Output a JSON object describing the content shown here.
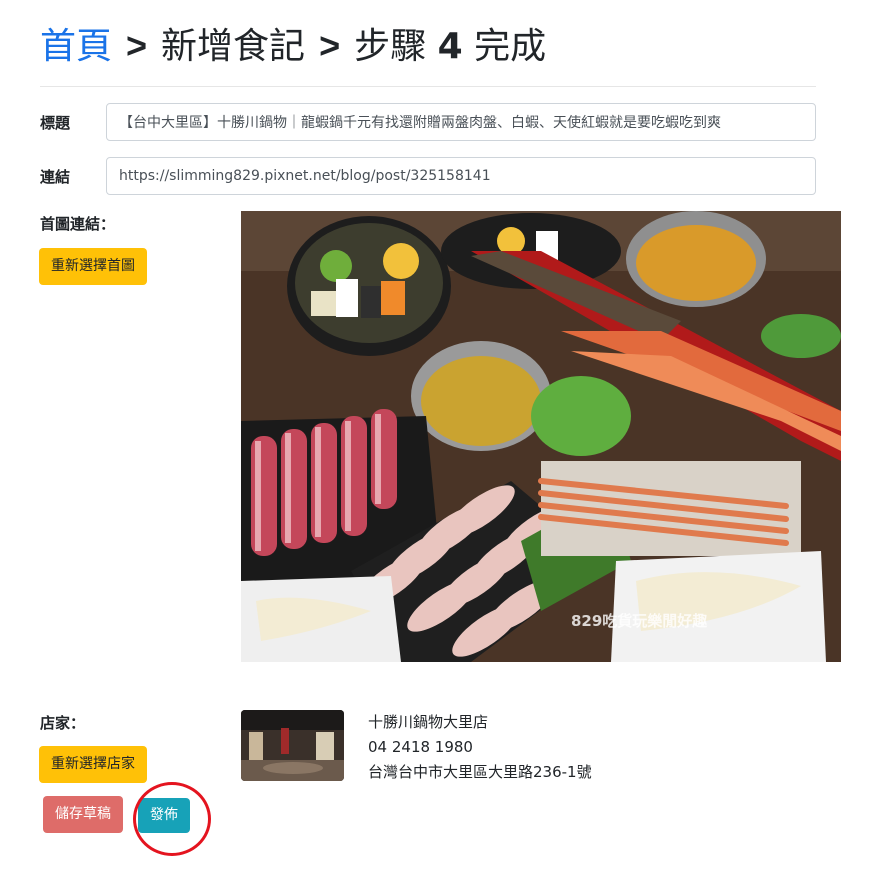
{
  "breadcrumb": {
    "home": "首頁",
    "separator": ">",
    "add_note": "新增食記",
    "step_prefix": "步驟",
    "step_number": "4",
    "step_suffix": "完成"
  },
  "form": {
    "title_label": "標題",
    "title_value": "【台中大里區】十勝川鍋物｜龍蝦鍋千元有找還附贈兩盤肉盤、白蝦、天使紅蝦就是要吃蝦吃到爽",
    "link_label": "連結",
    "link_value": "https://slimming829.pixnet.net/blog/post/325158141",
    "cover_label": "首圖連結：",
    "reselect_cover": "重新選擇首圖",
    "cover_watermark": "829吃貨玩樂閒好趣",
    "store_label": "店家：",
    "reselect_store": "重新選擇店家"
  },
  "store": {
    "name": "十勝川鍋物大里店",
    "phone": "04 2418 1980",
    "address": "台灣台中市大里區大里路236-1號"
  },
  "actions": {
    "save_draft": "儲存草稿",
    "publish": "發佈"
  },
  "colors": {
    "accent_link": "#1a73e8",
    "warning": "#ffc107",
    "danger": "#d9534f",
    "info": "#17a2b8",
    "highlight": "#e4141f"
  }
}
